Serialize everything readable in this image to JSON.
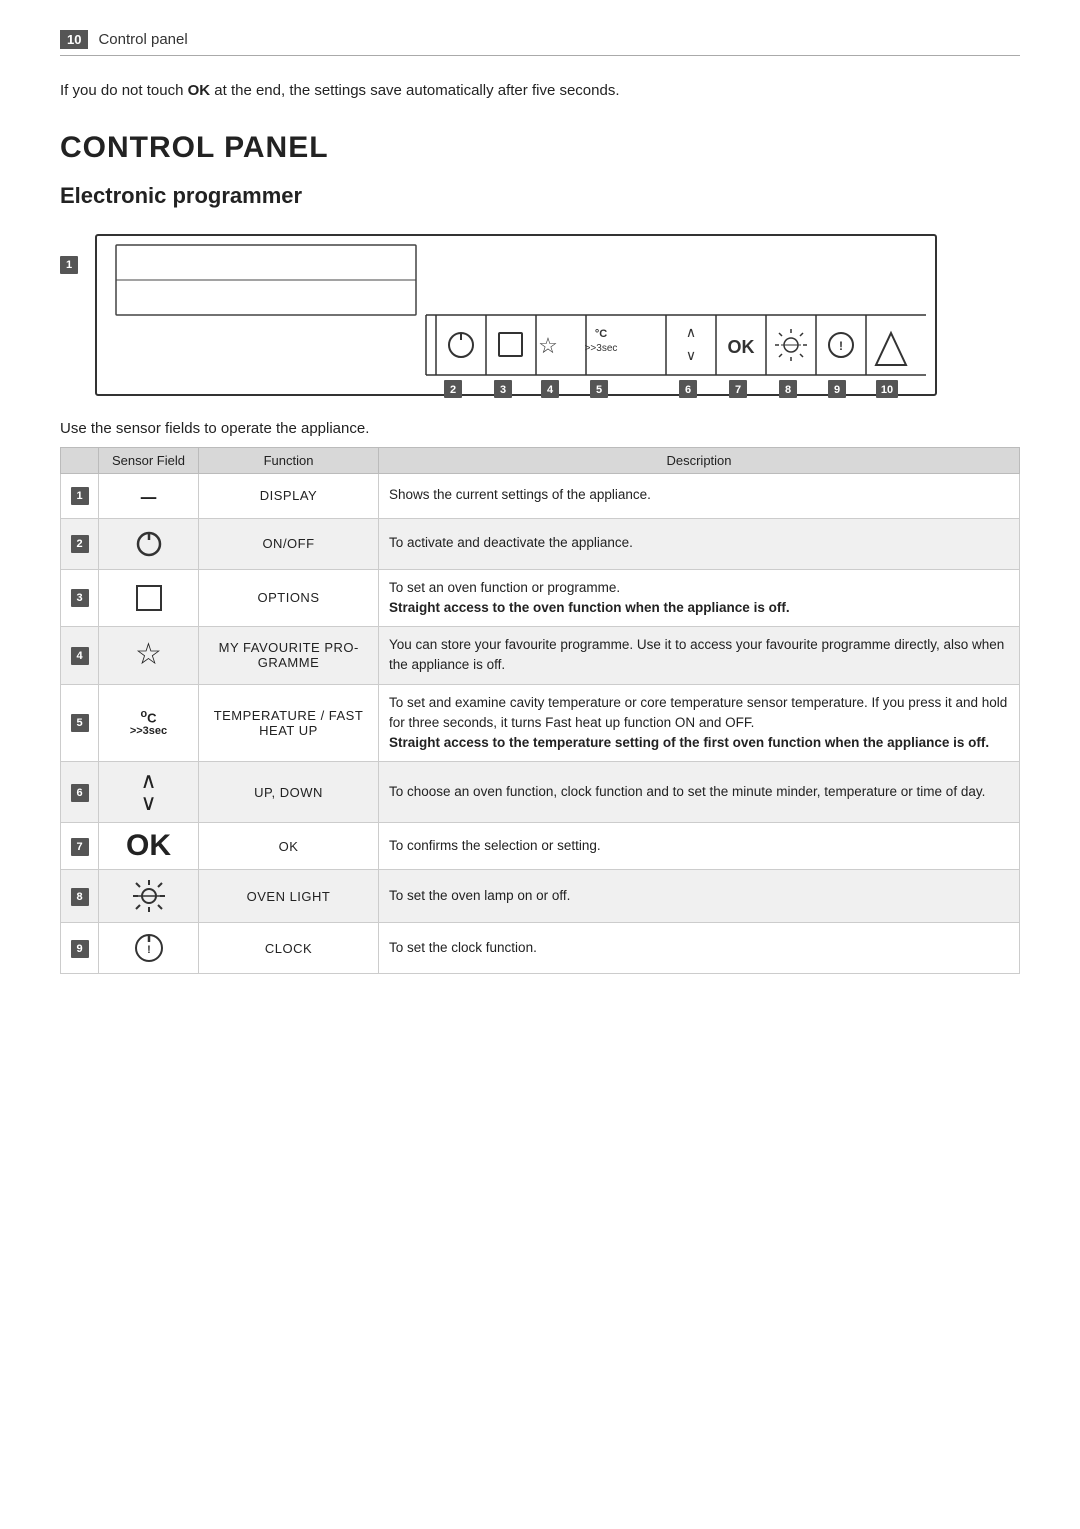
{
  "header": {
    "page_number": "10",
    "title": "Control panel"
  },
  "intro": {
    "text": "If you do not touch OK at the end, the settings save automatically after five seconds."
  },
  "section": {
    "title": "CONTROL PANEL",
    "subsection": "Electronic programmer",
    "instruction": "Use the sensor fields to operate the appliance."
  },
  "diagram": {
    "badge1": "1",
    "badges": [
      "2",
      "3",
      "4",
      "5",
      "6",
      "7",
      "8",
      "9",
      "10"
    ]
  },
  "table": {
    "headers": [
      "",
      "Sensor Field",
      "Function",
      "Description"
    ],
    "rows": [
      {
        "num": "1",
        "sensor": "–",
        "function": "DISPLAY",
        "description": "Shows the current settings of the appliance.",
        "icon": "none"
      },
      {
        "num": "2",
        "sensor": "power-icon",
        "function": "ON/OFF",
        "description": "To activate and deactivate the appliance.",
        "icon": "power"
      },
      {
        "num": "3",
        "sensor": "options-icon",
        "function": "OPTIONS",
        "description": "To set an oven function or programme.\nStraight access to the oven function when the appliance is off.",
        "icon": "options"
      },
      {
        "num": "4",
        "sensor": "star-icon",
        "function": "MY FAVOURITE PROGRAMME",
        "description": "You can store your favourite programme. Use it to access your favourite programme directly, also when the appliance is off.",
        "icon": "star"
      },
      {
        "num": "5",
        "sensor": "temp-icon",
        "function": "TEMPERATURE / FAST HEAT UP",
        "description": "To set and examine cavity temperature or core temperature sensor temperature. If you press it and hold for three seconds, it turns Fast heat up function ON and OFF.\nStraight access to the temperature setting of the first oven function when the appliance is off.",
        "icon": "temp"
      },
      {
        "num": "6",
        "sensor": "arrows-icon",
        "function": "UP, DOWN",
        "description": "To choose an oven function, clock function and to set the minute minder, temperature or time of day.",
        "icon": "arrows"
      },
      {
        "num": "7",
        "sensor": "ok-icon",
        "function": "OK",
        "description": "To confirms the selection or setting.",
        "icon": "ok"
      },
      {
        "num": "8",
        "sensor": "light-icon",
        "function": "OVEN LIGHT",
        "description": "To set the oven lamp on or off.",
        "icon": "light"
      },
      {
        "num": "9",
        "sensor": "clock-icon",
        "function": "CLOCK",
        "description": "To set the clock function.",
        "icon": "clock"
      }
    ]
  }
}
